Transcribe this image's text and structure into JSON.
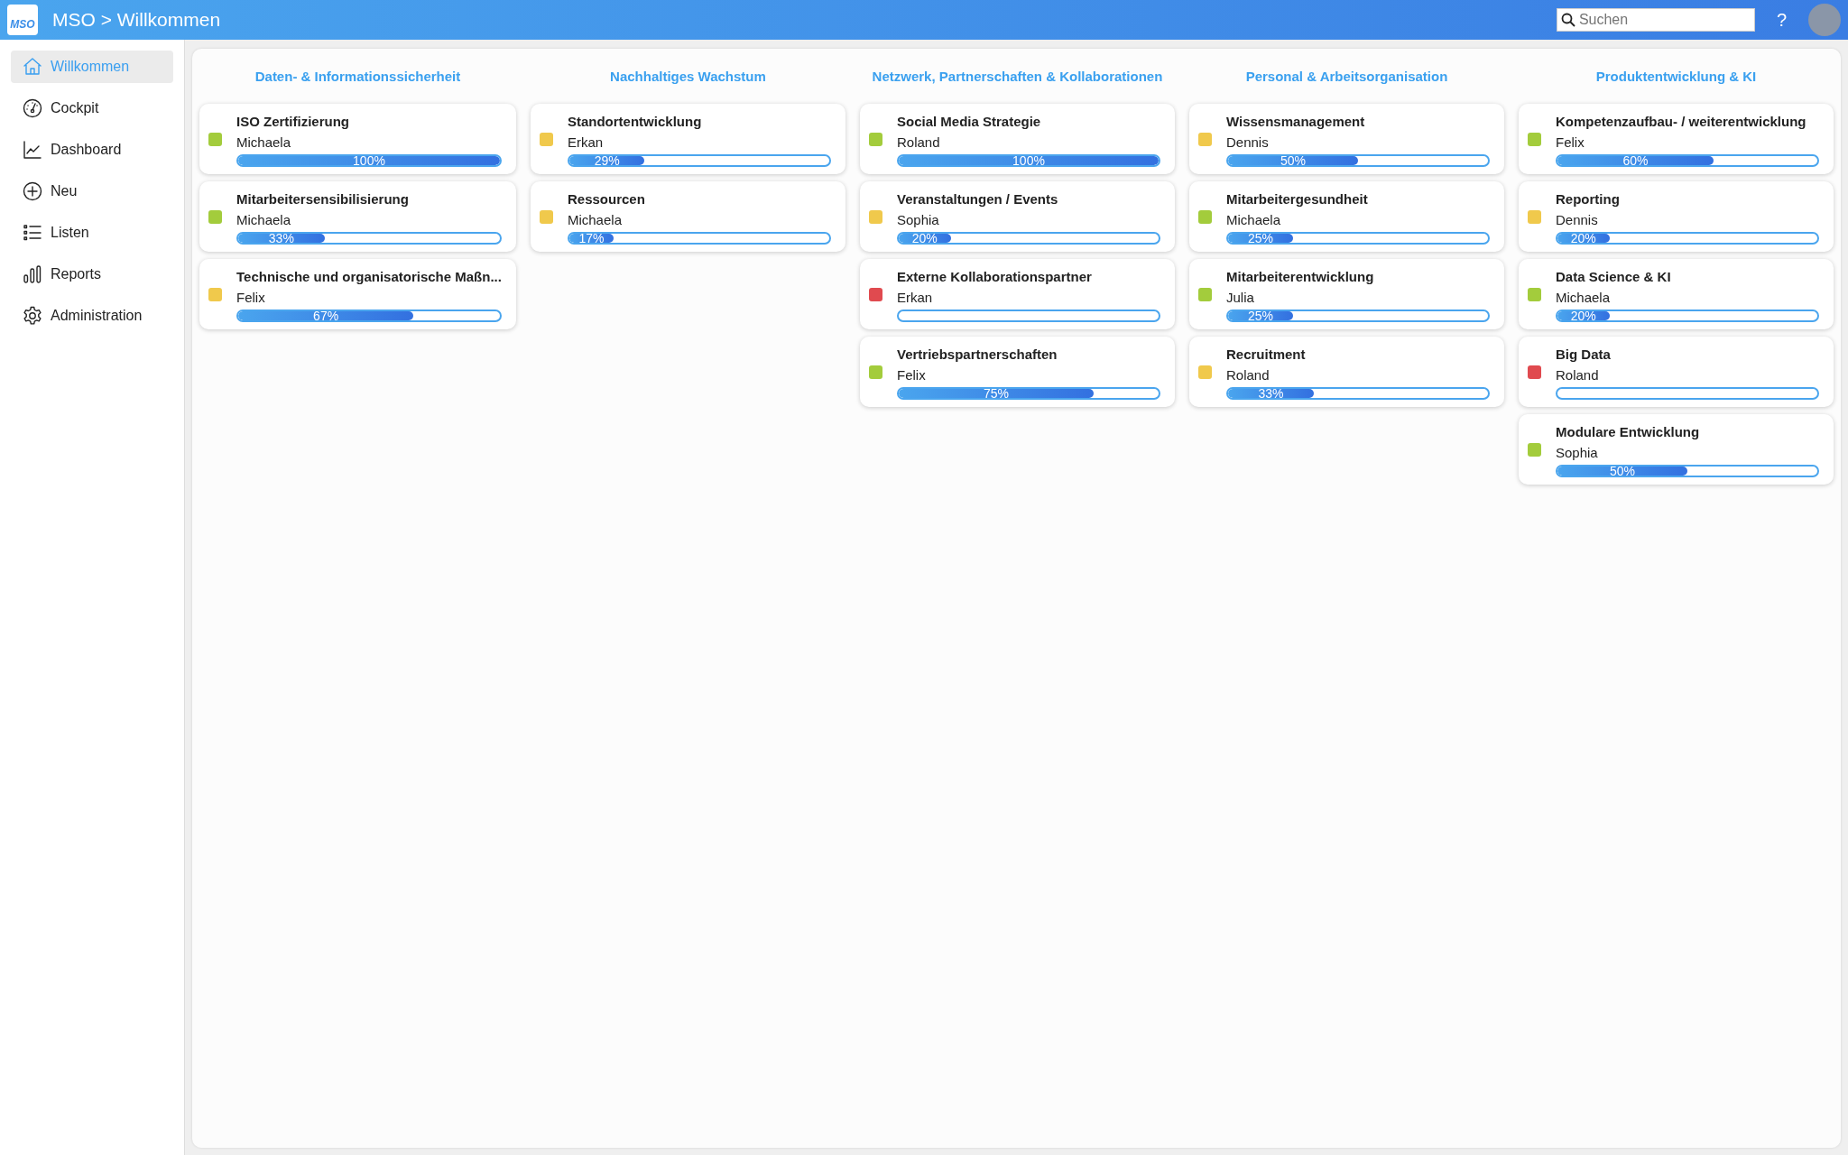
{
  "header": {
    "logo_text": "MSO",
    "title": "MSO > Willkommen",
    "search": {
      "placeholder": "Suchen"
    },
    "help": "?"
  },
  "sidebar": {
    "items": [
      {
        "label": "Willkommen",
        "selected": true
      },
      {
        "label": "Cockpit",
        "selected": false
      },
      {
        "label": "Dashboard",
        "selected": false
      },
      {
        "label": "Neu",
        "selected": false
      },
      {
        "label": "Listen",
        "selected": false
      },
      {
        "label": "Reports",
        "selected": false
      },
      {
        "label": "Administration",
        "selected": false
      }
    ]
  },
  "board": {
    "columns": [
      {
        "title": "Daten- & Informationssicherheit",
        "cards": [
          {
            "title": "ISO Zertifizierung",
            "owner": "Michaela",
            "color": "#a3cc3c",
            "level": 1.0,
            "percent": "100%"
          },
          {
            "title": "Mitarbeitersensibilisierung",
            "owner": "Michaela",
            "color": "#a3cc3c",
            "level": 0.33,
            "percent": "33%"
          },
          {
            "title": "Technische und organisatorische Maßn...",
            "owner": "Felix",
            "color": "#f0c94c",
            "level": 0.67,
            "percent": "67%"
          }
        ]
      },
      {
        "title": "Nachhaltiges Wachstum",
        "cards": [
          {
            "title": "Standortentwicklung",
            "owner": "Erkan",
            "color": "#f0c94c",
            "level": 0.29,
            "percent": "29%"
          },
          {
            "title": "Ressourcen",
            "owner": "Michaela",
            "color": "#f0c94c",
            "level": 0.17,
            "percent": "17%"
          }
        ]
      },
      {
        "title": "Netzwerk, Partnerschaften & Kollaborationen",
        "cards": [
          {
            "title": "Social Media Strategie",
            "owner": "Roland",
            "color": "#a3cc3c",
            "level": 1.0,
            "percent": "100%"
          },
          {
            "title": "Veranstaltungen / Events",
            "owner": "Sophia",
            "color": "#f0c94c",
            "level": 0.2,
            "percent": "20%"
          },
          {
            "title": "Externe Kollaborationspartner",
            "owner": "Erkan",
            "color": "#e04a4f",
            "level": 0
          },
          {
            "title": "Vertriebspartnerschaften",
            "owner": "Felix",
            "color": "#a3cc3c",
            "level": 0.75,
            "percent": "75%"
          }
        ]
      },
      {
        "title": "Personal & Arbeitsorganisation",
        "cards": [
          {
            "title": "Wissensmanagement",
            "owner": "Dennis",
            "color": "#f0c94c",
            "level": 0.5,
            "percent": "50%"
          },
          {
            "title": "Mitarbeitergesundheit",
            "owner": "Michaela",
            "color": "#a3cc3c",
            "level": 0.25,
            "percent": "25%"
          },
          {
            "title": "Mitarbeiterentwicklung",
            "owner": "Julia",
            "color": "#a3cc3c",
            "level": 0.25,
            "percent": "25%"
          },
          {
            "title": "Recruitment",
            "owner": "Roland",
            "color": "#f0c94c",
            "level": 0.33,
            "percent": "33%"
          }
        ]
      },
      {
        "title": "Produktentwicklung & KI",
        "cards": [
          {
            "title": "Kompetenzaufbau- / weiterentwicklung",
            "owner": "Felix",
            "color": "#a3cc3c",
            "level": 0.6,
            "percent": "60%"
          },
          {
            "title": "Reporting",
            "owner": "Dennis",
            "color": "#f0c94c",
            "level": 0.2,
            "percent": "20%"
          },
          {
            "title": "Data Science & KI",
            "owner": "Michaela",
            "color": "#a3cc3c",
            "level": 0.2,
            "percent": "20%"
          },
          {
            "title": "Big Data",
            "owner": "Roland",
            "color": "#e04a4f",
            "level": 0
          },
          {
            "title": "Modulare Entwicklung",
            "owner": "Sophia",
            "color": "#a3cc3c",
            "level": 0.5,
            "percent": "50%"
          }
        ]
      }
    ]
  }
}
